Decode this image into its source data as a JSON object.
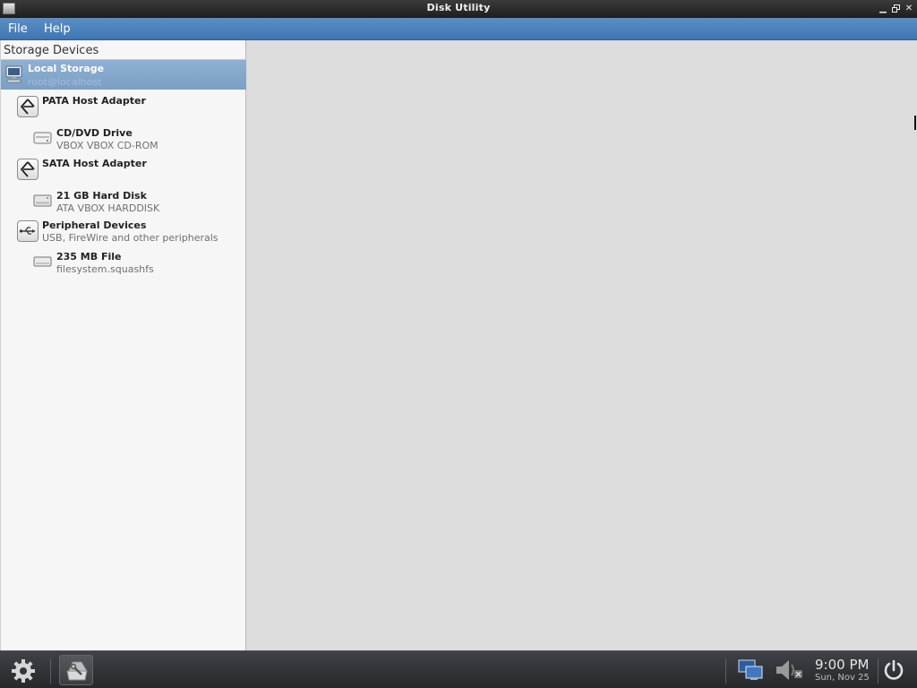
{
  "window": {
    "title": "Disk Utility",
    "minimize_glyph": "▁",
    "restore_glyph": "▫",
    "close_glyph": "✕"
  },
  "menubar": {
    "items": [
      {
        "label": "File"
      },
      {
        "label": "Help"
      }
    ]
  },
  "sidebar": {
    "header": "Storage Devices",
    "items": [
      {
        "name": "Local Storage",
        "sub": "root@localhost",
        "icon": "computer-icon",
        "selected": true
      },
      {
        "name": "PATA Host Adapter",
        "sub": "",
        "icon": "host-adapter-icon"
      },
      {
        "name": "CD/DVD Drive",
        "sub": "VBOX VBOX CD-ROM",
        "icon": "optical-drive-icon"
      },
      {
        "name": "SATA Host Adapter",
        "sub": "",
        "icon": "host-adapter-icon"
      },
      {
        "name": "21 GB Hard Disk",
        "sub": "ATA VBOX HARDDISK",
        "icon": "hard-disk-icon"
      },
      {
        "name": "Peripheral Devices",
        "sub": "USB, FireWire and other peripherals",
        "icon": "usb-icon"
      },
      {
        "name": "235 MB File",
        "sub": "filesystem.squashfs",
        "icon": "file-disk-icon"
      }
    ]
  },
  "taskbar": {
    "clock_time": "9:00 PM",
    "clock_date": "Sun, Nov 25"
  },
  "colors": {
    "menubar": "#4a81bb",
    "selection": "#85a8cc",
    "taskbar": "#2f3235"
  }
}
